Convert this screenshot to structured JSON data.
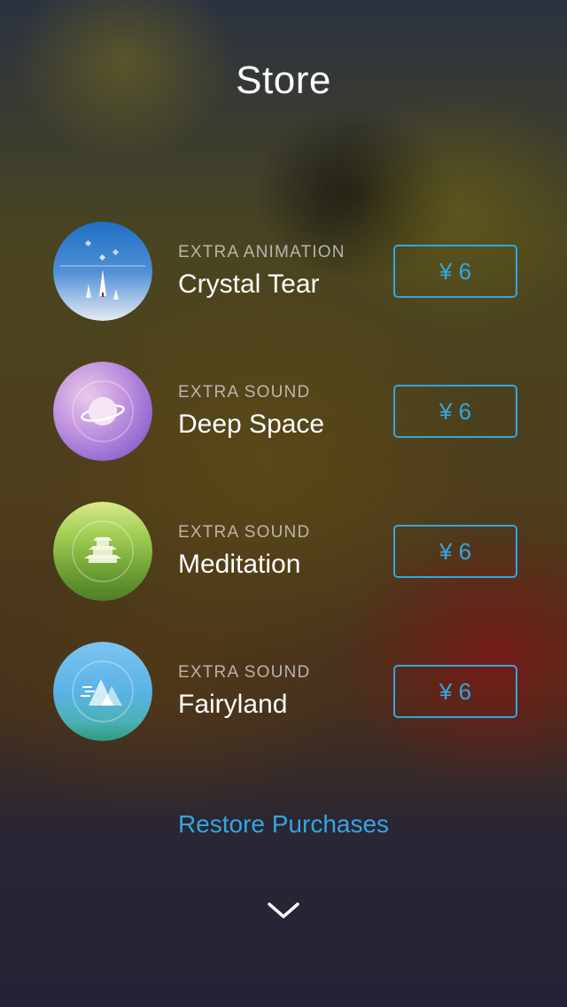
{
  "page": {
    "title": "Store",
    "restore_label": "Restore Purchases"
  },
  "colors": {
    "accent": "#33a6e0",
    "text_primary": "#ffffff",
    "text_secondary": "#bdbdbd"
  },
  "items": [
    {
      "category": "EXTRA ANIMATION",
      "name": "Crystal Tear",
      "price": "¥ 6",
      "icon": "crystal-tear-icon"
    },
    {
      "category": "EXTRA SOUND",
      "name": "Deep Space",
      "price": "¥ 6",
      "icon": "planet-icon"
    },
    {
      "category": "EXTRA SOUND",
      "name": "Meditation",
      "price": "¥ 6",
      "icon": "pagoda-icon"
    },
    {
      "category": "EXTRA SOUND",
      "name": "Fairyland",
      "price": "¥ 6",
      "icon": "mountains-icon"
    }
  ],
  "footer": {
    "dismiss_icon": "chevron-down-icon"
  }
}
